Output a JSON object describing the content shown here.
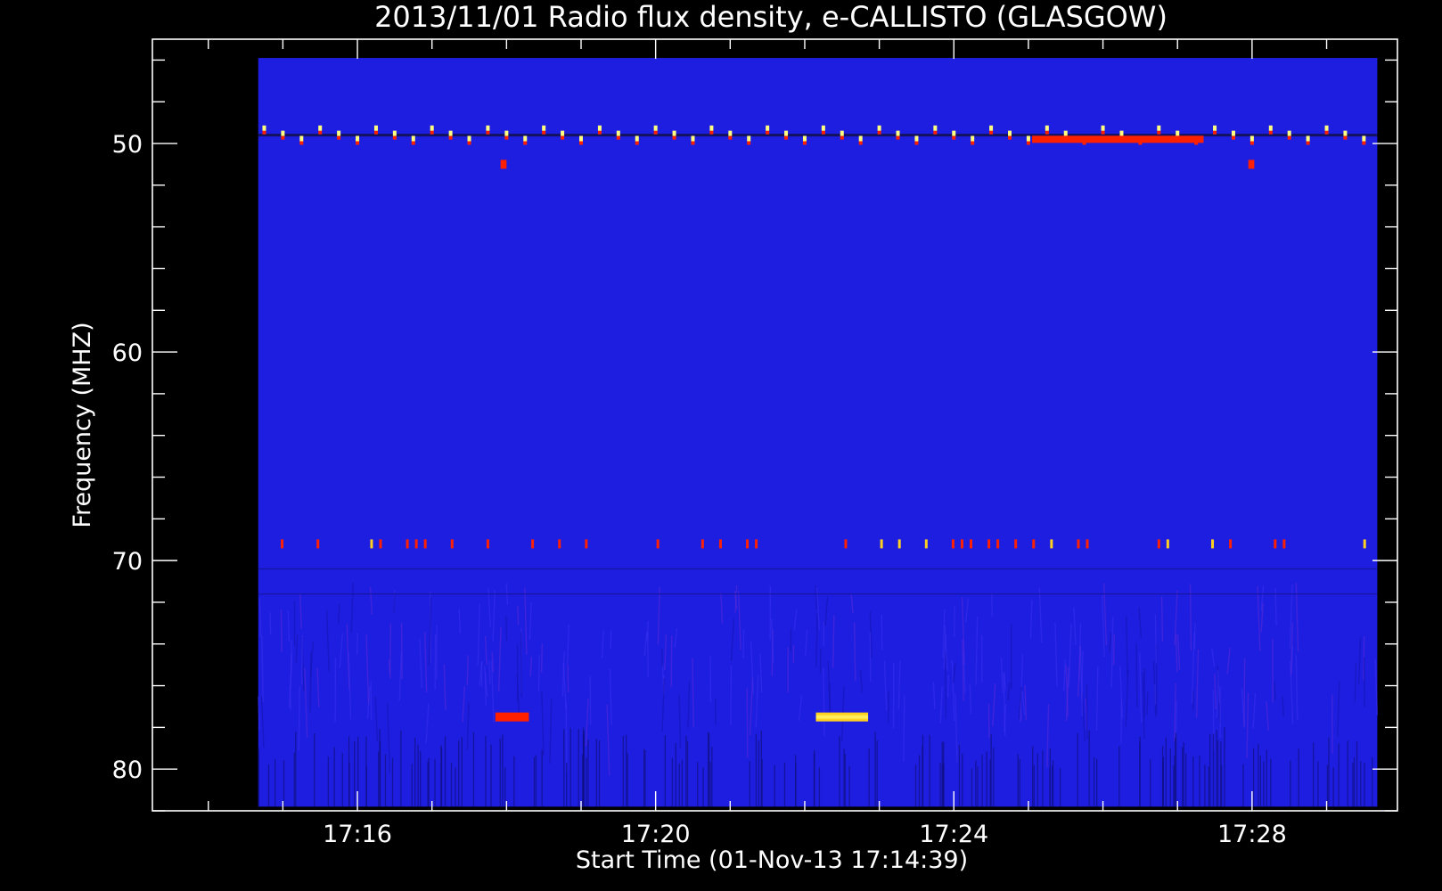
{
  "chart_data": {
    "type": "heatmap",
    "title": "2013/11/01  Radio flux density, e-CALLISTO (GLASGOW)",
    "xlabel": "Start Time (01-Nov-13 17:14:39)",
    "ylabel": "Frequency (MHZ)",
    "x_unit": "minutes after 17:14:39 UT",
    "xlim": [
      -1.4,
      15.3
    ],
    "ylim": [
      45,
      82
    ],
    "y_reversed": true,
    "data_extent": {
      "x": [
        0.02,
        15.03
      ],
      "y": [
        45.9,
        81.8
      ]
    },
    "x_ticks": [
      {
        "label": "17:16",
        "value": 1.35
      },
      {
        "label": "17:20",
        "value": 5.35
      },
      {
        "label": "17:24",
        "value": 9.35
      },
      {
        "label": "17:28",
        "value": 13.35
      }
    ],
    "y_ticks": [
      {
        "label": "50",
        "value": 50
      },
      {
        "label": "60",
        "value": 60
      },
      {
        "label": "70",
        "value": 70
      },
      {
        "label": "80",
        "value": 80
      }
    ],
    "colormap": [
      "#0a0a50",
      "#1a1ad0",
      "#4a3af0",
      "#c02020",
      "#ff2000",
      "#ffd020",
      "#ffff80"
    ],
    "background_color": "#1e1ee0",
    "features": [
      {
        "name": "periodic-spikes-49.5MHz",
        "freq": 49.6,
        "x_start": 0.1,
        "x_end": 15.0,
        "period": 0.25,
        "level": 6
      },
      {
        "name": "continuous-band-49.8MHz",
        "freq": 49.8,
        "x_start": 10.4,
        "x_end": 12.7,
        "level": 4
      },
      {
        "name": "spot-51MHz-a",
        "freq": 51.0,
        "x_start": 3.27,
        "x_end": 3.35,
        "level": 4
      },
      {
        "name": "spot-51MHz-b",
        "freq": 51.0,
        "x_start": 13.3,
        "x_end": 13.38,
        "level": 4
      },
      {
        "name": "sparse-spikes-69MHz",
        "freq": 69.2,
        "x_start": 0.1,
        "x_end": 15.0,
        "level": 4
      },
      {
        "name": "burst-77.5MHz-a",
        "freq": 77.5,
        "x_start": 3.2,
        "x_end": 3.65,
        "level": 4
      },
      {
        "name": "burst-77.5MHz-b",
        "freq": 77.5,
        "x_start": 7.5,
        "x_end": 8.2,
        "level": 5
      }
    ]
  }
}
